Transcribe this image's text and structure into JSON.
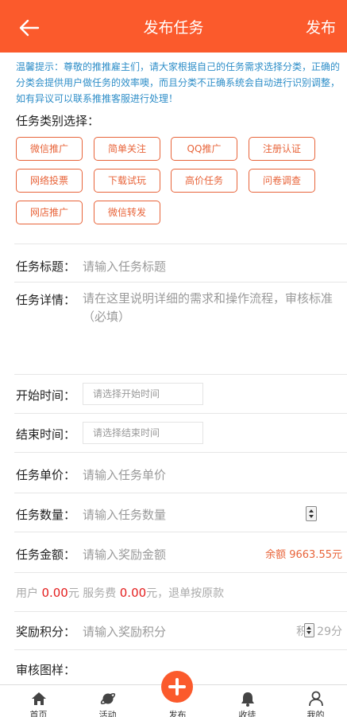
{
  "colors": {
    "accent": "#fb5a2c",
    "tip": "#2e8ec8",
    "chip": "#e8643a",
    "money": "#e42020"
  },
  "header": {
    "title": "发布任务",
    "publish": "发布",
    "back_icon": "arrow-left-icon"
  },
  "tip": "温馨提示：尊敬的推推雇主们，请大家根据自己的任务需求选择分类，正确的分类会提供用户做任务的效率噢，而且分类不正确系统会自动进行识别调整，如有异议可以联系推推客服进行处理！",
  "category_label": "任务类别选择：",
  "categories": [
    "微信推广",
    "简单关注",
    "QQ推广",
    "注册认证",
    "网络投票",
    "下载试玩",
    "高价任务",
    "问卷调查",
    "网店推广",
    "微信转发"
  ],
  "form": {
    "title_label": "任务标题：",
    "title_placeholder": "请输入任务标题",
    "detail_label": "任务详情：",
    "detail_placeholder": "请在这里说明详细的需求和操作流程，审核标准（必填）",
    "start_label": "开始时间：",
    "start_placeholder": "请选择开始时间",
    "end_label": "结束时间：",
    "end_placeholder": "请选择结束时间",
    "price_label": "任务单价：",
    "price_placeholder": "请输入任务单价",
    "qty_label": "任务数量：",
    "qty_placeholder": "请输入任务数量",
    "amount_label": "任务金额：",
    "amount_placeholder": "请输入奖励金额",
    "balance": "余额 9663.55元",
    "fee_user": "用户",
    "fee_user_value": "0.00",
    "fee_yuan1": "元 服务费",
    "fee_service_value": "0.00",
    "fee_tail": "元，退单按原款",
    "points_label": "奖励积分：",
    "points_placeholder": "请输入奖励积分",
    "points_suffix_a": "积",
    "points_suffix_b": "29分",
    "sample_label": "审核图样："
  },
  "tabbar": [
    {
      "label": "首页",
      "icon": "home-icon"
    },
    {
      "label": "活动",
      "icon": "planet-icon"
    },
    {
      "label": "发布",
      "icon": "plus-icon"
    },
    {
      "label": "收徒",
      "icon": "bell-icon"
    },
    {
      "label": "我的",
      "icon": "user-icon"
    }
  ]
}
